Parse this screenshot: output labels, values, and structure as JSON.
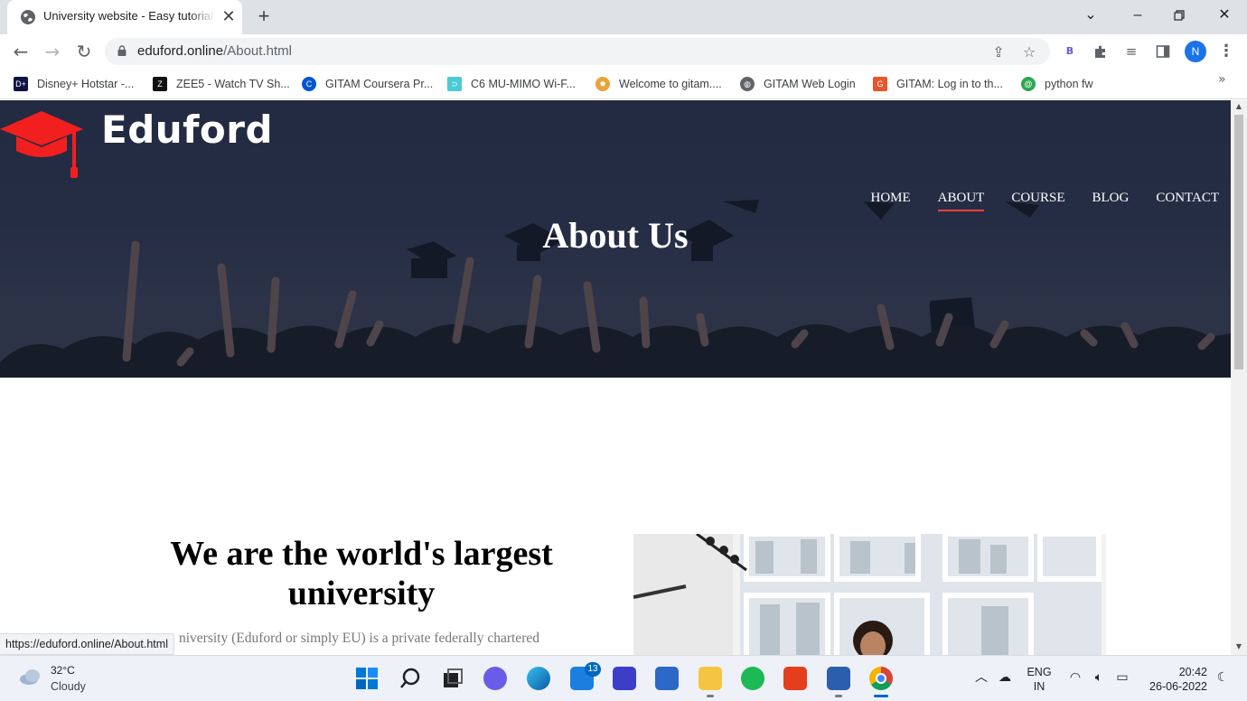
{
  "browser": {
    "tab_title": "University website - Easy tutorials",
    "close_glyph": "✕",
    "new_tab_glyph": "+",
    "url_domain": "eduford.online",
    "url_path": "/About.html",
    "profile_initial": "N",
    "extension_label": "B",
    "bookmarks": [
      {
        "label": "Disney+ Hotstar -...",
        "icon": "hotstar-icon",
        "color": "#0c1445"
      },
      {
        "label": "ZEE5 - Watch TV Sh...",
        "icon": "zee5-icon",
        "color": "#111111"
      },
      {
        "label": "GITAM Coursera Pr...",
        "icon": "coursera-icon",
        "color": "#0056d2"
      },
      {
        "label": "C6 MU-MIMO Wi-F...",
        "icon": "tplink-icon",
        "color": "#4acbd6"
      },
      {
        "label": "Welcome to gitam....",
        "icon": "gitam-sun-icon",
        "color": "#e9a23b"
      },
      {
        "label": "GITAM Web Login",
        "icon": "globe-icon",
        "color": "#5f6368"
      },
      {
        "label": "GITAM: Log in to th...",
        "icon": "gitam-logo-icon",
        "color": "#e8562a"
      },
      {
        "label": "python fw",
        "icon": "spiral-icon",
        "color": "#2fa84f"
      }
    ],
    "bookmarks_overflow": "»",
    "status_url": "https://eduford.online/About.html"
  },
  "site": {
    "logo_text": "Eduford",
    "brand_color": "#f44336",
    "nav": [
      {
        "label": "HOME",
        "active": false
      },
      {
        "label": "ABOUT",
        "active": true
      },
      {
        "label": "COURSE",
        "active": false
      },
      {
        "label": "BLOG",
        "active": false
      },
      {
        "label": "CONTACT",
        "active": false
      }
    ],
    "hero_title": "About Us",
    "about_heading": "We are the world's largest university",
    "about_text": "niversity (Eduford or simply EU) is a private federally chartered"
  },
  "taskbar": {
    "weather_temp": "32°C",
    "weather_desc": "Cloudy",
    "mail_badge": "13",
    "language_primary": "ENG",
    "language_secondary": "IN",
    "time": "20:42",
    "date": "26-06-2022"
  }
}
